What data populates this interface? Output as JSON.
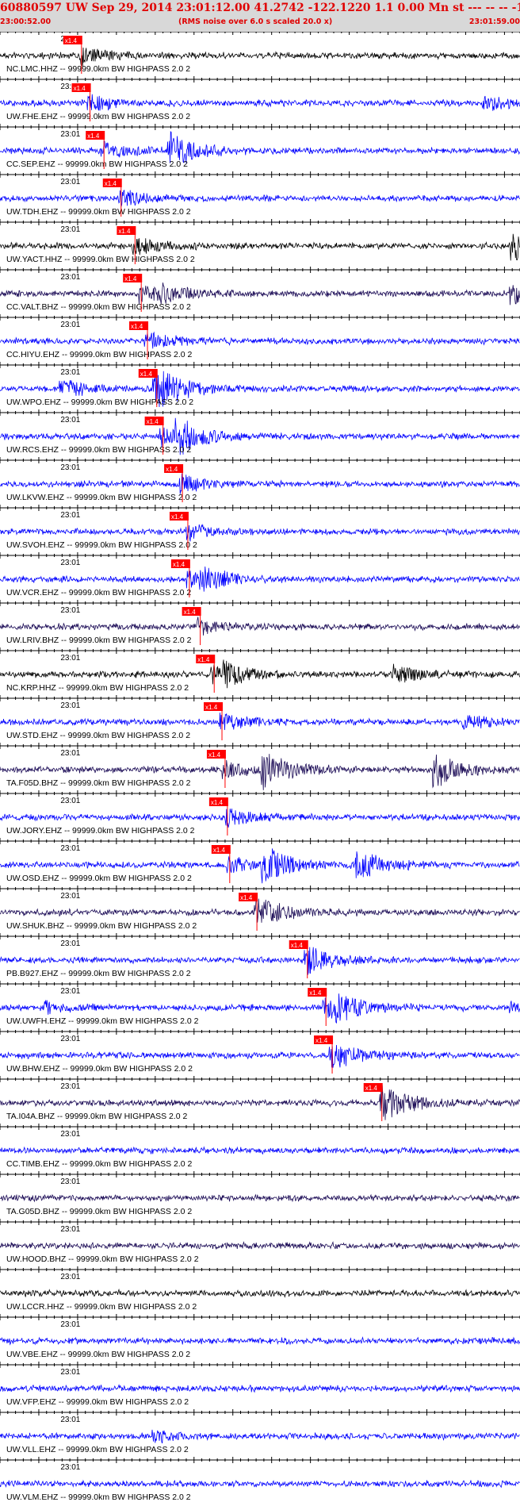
{
  "header": {
    "title": "60880597 UW Sep 29, 2014 23:01:12.00   41.2742 -122.1220  1.1 0.00 Mn st --- -- --   -1",
    "start_time": "23:00:52.00",
    "rms_note": "(RMS noise over 6.0 s scaled 20.0 x)",
    "end_time": "23:01:59.00"
  },
  "colors": {
    "black_trace": "#000000",
    "blue_trace": "#0000ff",
    "dark_trace": "#1a0a55",
    "pick": "#ff0000",
    "header_text": "#e00000",
    "header_bg": "#d8d8d8"
  },
  "chart_data": {
    "type": "line",
    "x_axis": {
      "start": "23:00:52.00",
      "end": "23:01:59.00",
      "minute_label": "23:01"
    },
    "pick_label": "x1.4",
    "traces": [
      {
        "station": "NC.LMC.HHZ -- 99999.0km BW  HIGHPASS  2.0  2",
        "color": "black",
        "pick_time": "23:01:02.5",
        "scale": "x1.4",
        "events": []
      },
      {
        "station": "UW.FHE.EHZ -- 99999.0km BW  HIGHPASS  2.0  2",
        "color": "blue",
        "pick_time": "23:01:03.6",
        "scale": "x1.4",
        "events": [
          {
            "at": "23:01:54.5",
            "level": 0.35
          }
        ]
      },
      {
        "station": "CC.SEP.EHZ -- 99999.0km BW  HIGHPASS  2.0  2",
        "color": "blue",
        "pick_time": "23:01:05.4",
        "scale": "x1.4",
        "events": [
          {
            "at": "23:01:14",
            "level": 1.0
          }
        ]
      },
      {
        "station": "UW.TDH.EHZ -- 99999.0km BW  HIGHPASS  2.0  2",
        "color": "blue",
        "pick_time": "23:01:07.6",
        "scale": "x1.4",
        "events": []
      },
      {
        "station": "UW.YACT.HHZ -- 99999.0km BW  HIGHPASS  2.0  2",
        "color": "black",
        "pick_time": "23:01:09.4",
        "scale": "x1.4",
        "events": [
          {
            "at": "23:01:58",
            "level": 0.8
          }
        ]
      },
      {
        "station": "CC.VALT.BHZ -- 99999.0km BW  HIGHPASS  2.0  2",
        "color": "dark",
        "pick_time": "23:01:10.2",
        "scale": "x1.4",
        "events": [
          {
            "at": "23:01:13",
            "level": 0.35
          },
          {
            "at": "23:01:58",
            "level": 0.6
          }
        ]
      },
      {
        "station": "CC.HIYU.EHZ -- 99999.0km BW  HIGHPASS  2.0  2",
        "color": "blue",
        "pick_time": "23:01:11.0",
        "scale": "x1.4",
        "events": []
      },
      {
        "station": "UW.WPO.EHZ -- 99999.0km BW  HIGHPASS  2.0  2",
        "color": "blue",
        "pick_time": "23:01:12.2",
        "scale": "x1.4",
        "events": [
          {
            "at": "23:01:00",
            "level": 0.5
          },
          {
            "at": "23:01:12",
            "level": 0.9
          }
        ]
      },
      {
        "station": "UW.RCS.EHZ -- 99999.0km BW  HIGHPASS  2.0  2",
        "color": "blue",
        "pick_time": "23:01:13.0",
        "scale": "x1.4",
        "events": [
          {
            "at": "23:01:15",
            "level": 0.9
          }
        ]
      },
      {
        "station": "UW.LKVW.EHZ -- 99999.0km BW  HIGHPASS  2.0  2",
        "color": "blue",
        "pick_time": "23:01:15.5",
        "scale": "x1.4",
        "events": []
      },
      {
        "station": "UW.SVOH.EHZ -- 99999.0km BW  HIGHPASS  2.0  2",
        "color": "blue",
        "pick_time": "23:01:16.2",
        "scale": "x1.4",
        "events": []
      },
      {
        "station": "UW.VCR.EHZ -- 99999.0km BW  HIGHPASS  2.0  2",
        "color": "blue",
        "pick_time": "23:01:16.4",
        "scale": "x1.4",
        "events": [
          {
            "at": "23:01:18",
            "level": 0.55
          }
        ]
      },
      {
        "station": "UW.LRIV.BHZ -- 99999.0km BW  HIGHPASS  2.0  2",
        "color": "dark",
        "pick_time": "23:01:17.8",
        "scale": "x1.4",
        "events": []
      },
      {
        "station": "NC.KRP.HHZ -- 99999.0km BW  HIGHPASS  2.0  2",
        "color": "black",
        "pick_time": "23:01:19.6",
        "scale": "x1.4",
        "events": [
          {
            "at": "23:01:21",
            "level": 0.45
          },
          {
            "at": "23:01:43",
            "level": 0.5
          }
        ]
      },
      {
        "station": "UW.STD.EHZ -- 99999.0km BW  HIGHPASS  2.0  2",
        "color": "blue",
        "pick_time": "23:01:20.6",
        "scale": "x1.4",
        "events": [
          {
            "at": "23:01:52",
            "level": 0.35
          }
        ]
      },
      {
        "station": "TA.F05D.BHZ -- 99999.0km BW  HIGHPASS  2.0  2",
        "color": "dark",
        "pick_time": "23:01:21.0",
        "scale": "x1.4",
        "events": [
          {
            "at": "23:01:26",
            "level": 1.0
          },
          {
            "at": "23:01:48",
            "level": 1.0
          }
        ]
      },
      {
        "station": "UW.JORY.EHZ -- 99999.0km BW  HIGHPASS  2.0  2",
        "color": "blue",
        "pick_time": "23:01:21.3",
        "scale": "x1.4",
        "events": []
      },
      {
        "station": "UW.OSD.EHZ -- 99999.0km BW  HIGHPASS  2.0  2",
        "color": "blue",
        "pick_time": "23:01:21.6",
        "scale": "x1.4",
        "events": [
          {
            "at": "23:01:26",
            "level": 1.0
          },
          {
            "at": "23:01:38",
            "level": 0.8
          }
        ]
      },
      {
        "station": "UW.SHUK.BHZ -- 99999.0km BW  HIGHPASS  2.0  2",
        "color": "dark",
        "pick_time": "23:01:25.1",
        "scale": "x1.4",
        "events": [
          {
            "at": "23:01:25",
            "level": 0.45
          }
        ]
      },
      {
        "station": "PB.B927.EHZ -- 99999.0km BW  HIGHPASS  2.0  2",
        "color": "blue",
        "pick_time": "23:01:31.6",
        "scale": "x1.4",
        "events": [
          {
            "at": "23:01:32",
            "level": 0.3
          }
        ]
      },
      {
        "station": "UW.UWFH.EHZ -- 99999.0km BW  HIGHPASS  2.0  2",
        "color": "blue",
        "pick_time": "23:01:34.0",
        "scale": "x1.4",
        "events": [
          {
            "at": "23:01:35",
            "level": 0.7
          },
          {
            "at": "23:00:58",
            "level": 0.35
          },
          {
            "at": "23:01:58",
            "level": 0.3
          }
        ]
      },
      {
        "station": "UW.BHW.EHZ -- 99999.0km BW  HIGHPASS  2.0  2",
        "color": "blue",
        "pick_time": "23:01:34.8",
        "scale": "x1.4",
        "events": [
          {
            "at": "23:01:35",
            "level": 0.3
          }
        ]
      },
      {
        "station": "TA.I04A.BHZ -- 99999.0km BW  HIGHPASS  2.0  2",
        "color": "dark",
        "pick_time": "23:01:41.2",
        "scale": "x1.4",
        "events": [
          {
            "at": "23:01:41.5",
            "level": 0.55
          }
        ]
      },
      {
        "station": "CC.TIMB.EHZ -- 99999.0km BW  HIGHPASS  2.0  2",
        "color": "blue",
        "pick_time": null,
        "scale": null,
        "events": []
      },
      {
        "station": "TA.G05D.BHZ -- 99999.0km BW  HIGHPASS  2.0  2",
        "color": "dark",
        "pick_time": null,
        "scale": null,
        "events": []
      },
      {
        "station": "UW.HOOD.BHZ -- 99999.0km BW  HIGHPASS  2.0  2",
        "color": "dark",
        "pick_time": null,
        "scale": null,
        "events": []
      },
      {
        "station": "UW.LCCR.HHZ -- 99999.0km BW  HIGHPASS  2.0  2",
        "color": "black",
        "pick_time": null,
        "scale": null,
        "events": []
      },
      {
        "station": "UW.VBE.EHZ -- 99999.0km BW  HIGHPASS  2.0  2",
        "color": "blue",
        "pick_time": null,
        "scale": null,
        "events": []
      },
      {
        "station": "UW.VFP.EHZ -- 99999.0km BW  HIGHPASS  2.0  2",
        "color": "blue",
        "pick_time": null,
        "scale": null,
        "events": []
      },
      {
        "station": "UW.VLL.EHZ -- 99999.0km BW  HIGHPASS  2.0  2",
        "color": "blue",
        "pick_time": null,
        "scale": null,
        "events": [
          {
            "at": "23:01:12",
            "level": 0.3
          }
        ]
      },
      {
        "station": "UW.VLM.EHZ -- 99999.0km BW  HIGHPASS  2.0  2",
        "color": "blue",
        "pick_time": null,
        "scale": null,
        "events": []
      }
    ]
  }
}
